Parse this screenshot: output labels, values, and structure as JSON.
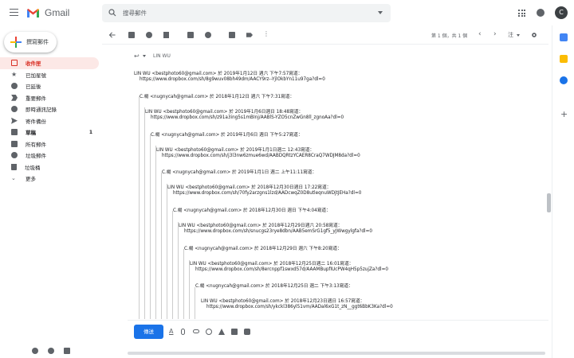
{
  "topbar": {
    "product_name": "Gmail",
    "search_placeholder": "搜尋郵件",
    "avatar_letter": "C",
    "colors": {
      "gmail_red": "#ea4335",
      "gmail_blue": "#4285f4",
      "gmail_yellow": "#fbbc04",
      "gmail_green": "#34a853"
    }
  },
  "leftnav": {
    "compose_label": "撰寫郵件",
    "items": [
      {
        "label": "收件匣",
        "icon": "inbox-icon",
        "active": true
      },
      {
        "label": "已加星號",
        "icon": "star-icon"
      },
      {
        "label": "已延後",
        "icon": "clock-icon"
      },
      {
        "label": "重要郵件",
        "icon": "important-icon"
      },
      {
        "label": "即時通訊記錄",
        "icon": "chat-icon"
      },
      {
        "label": "寄件備份",
        "icon": "send-icon"
      },
      {
        "label": "草稿",
        "icon": "draft-icon",
        "count": "1",
        "bold": true
      },
      {
        "label": "所有郵件",
        "icon": "mail-icon"
      },
      {
        "label": "垃圾郵件",
        "icon": "spam-icon"
      },
      {
        "label": "垃圾桶",
        "icon": "trash-icon"
      },
      {
        "label": "更多",
        "icon": "chevron-down-icon"
      }
    ]
  },
  "toolbar": {
    "pager": "第 1 個，共 1 個",
    "lang": "注"
  },
  "message": {
    "recipient": "LIN WU",
    "lines": [
      {
        "text": "LIN WU <bestphoto60@gmail.com> 於 2019年1月12日 週六 下午7:57寫道："
      },
      {
        "link": "https://www.dropbox.com/sh/8g9wuv08bh49dm/AACY9rz--YjlOkbYn11u97ga?dl=0"
      },
      {
        "text": "C.楊 <nugnycah@gmail.com> 於 2018年1月12日 週六 下午7:31寫道："
      },
      {
        "text": "LIN WU <bestphoto60@gmail.com> 於 2019年1月6日週日 18:48寫道："
      },
      {
        "link": "https://www.dropbox.com/sh/z91a3ing5s1mBInj/AABlS-YZO5cnZwGn8ll_zgnoAa?dl=0"
      },
      {
        "text": "C.楊 <nugnycah@gmail.com> 於 2019年1月6日 週日 下午5:27寫道："
      },
      {
        "text": "LIN WU <bestphoto60@gmail.com> 於 2019年1月1日週二 12:43寫道："
      },
      {
        "link": "https://www.dropbox.com/sh/j3l3nw6zmue6wd/AABDQRtzYCAER8CraQ7WDJM8da?dl=0"
      },
      {
        "text": "C.楊 <nugnycah@gmail.com> 於 2019年1月1日 週二 上午11:11寫道："
      },
      {
        "text": "LIN WU <bestphoto60@gmail.com> 於 2018年12月30日週日 17:22寫道："
      },
      {
        "link": "https://www.dropbox.com/sh/70fy2arzgns1lzd/AADcwqZ0D8utleqnuWDjtJEHa?dl=0"
      },
      {
        "text": "C.楊 <nugnycah@gmail.com> 於 2018年12月30日 週日 下午4:04寫道："
      },
      {
        "text": "LIN WU <bestphoto60@gmail.com> 於 2018年12月29日週六 20:58寫道："
      },
      {
        "link": "https://www.dropbox.com/sh/snucgs23rye8dbn/AAB5emSrG1gf5_yJWwgylgfa?dl=0"
      },
      {
        "text": "C.楊 <nugnycah@gmail.com> 於 2018年12月29日 週六 下午8:20寫道："
      },
      {
        "text": "LIN WU <bestphoto60@gmail.com> 於 2018年12月25日週二 16:01寫道："
      },
      {
        "link": "https://www.dropbox.com/sh/8ercnppf1swxd57d/AAAMBupfIUcPW4qH5p5zujZa?dl=0"
      },
      {
        "text": "C.楊 <nugnycah@gmail.com> 於 2018年12月25日 週二 下午3:13寫道："
      },
      {
        "text": "LIN WU <bestphoto60@gmail.com> 於 2018年12月23日週日 16:57寫道："
      },
      {
        "link": "https://www.dropbox.com/sh/ykckl386yl51vm/AADal6xG1t_zN__ggt6BbK3Ka?dl=0"
      }
    ]
  },
  "replybar": {
    "send_label": "傳送"
  }
}
